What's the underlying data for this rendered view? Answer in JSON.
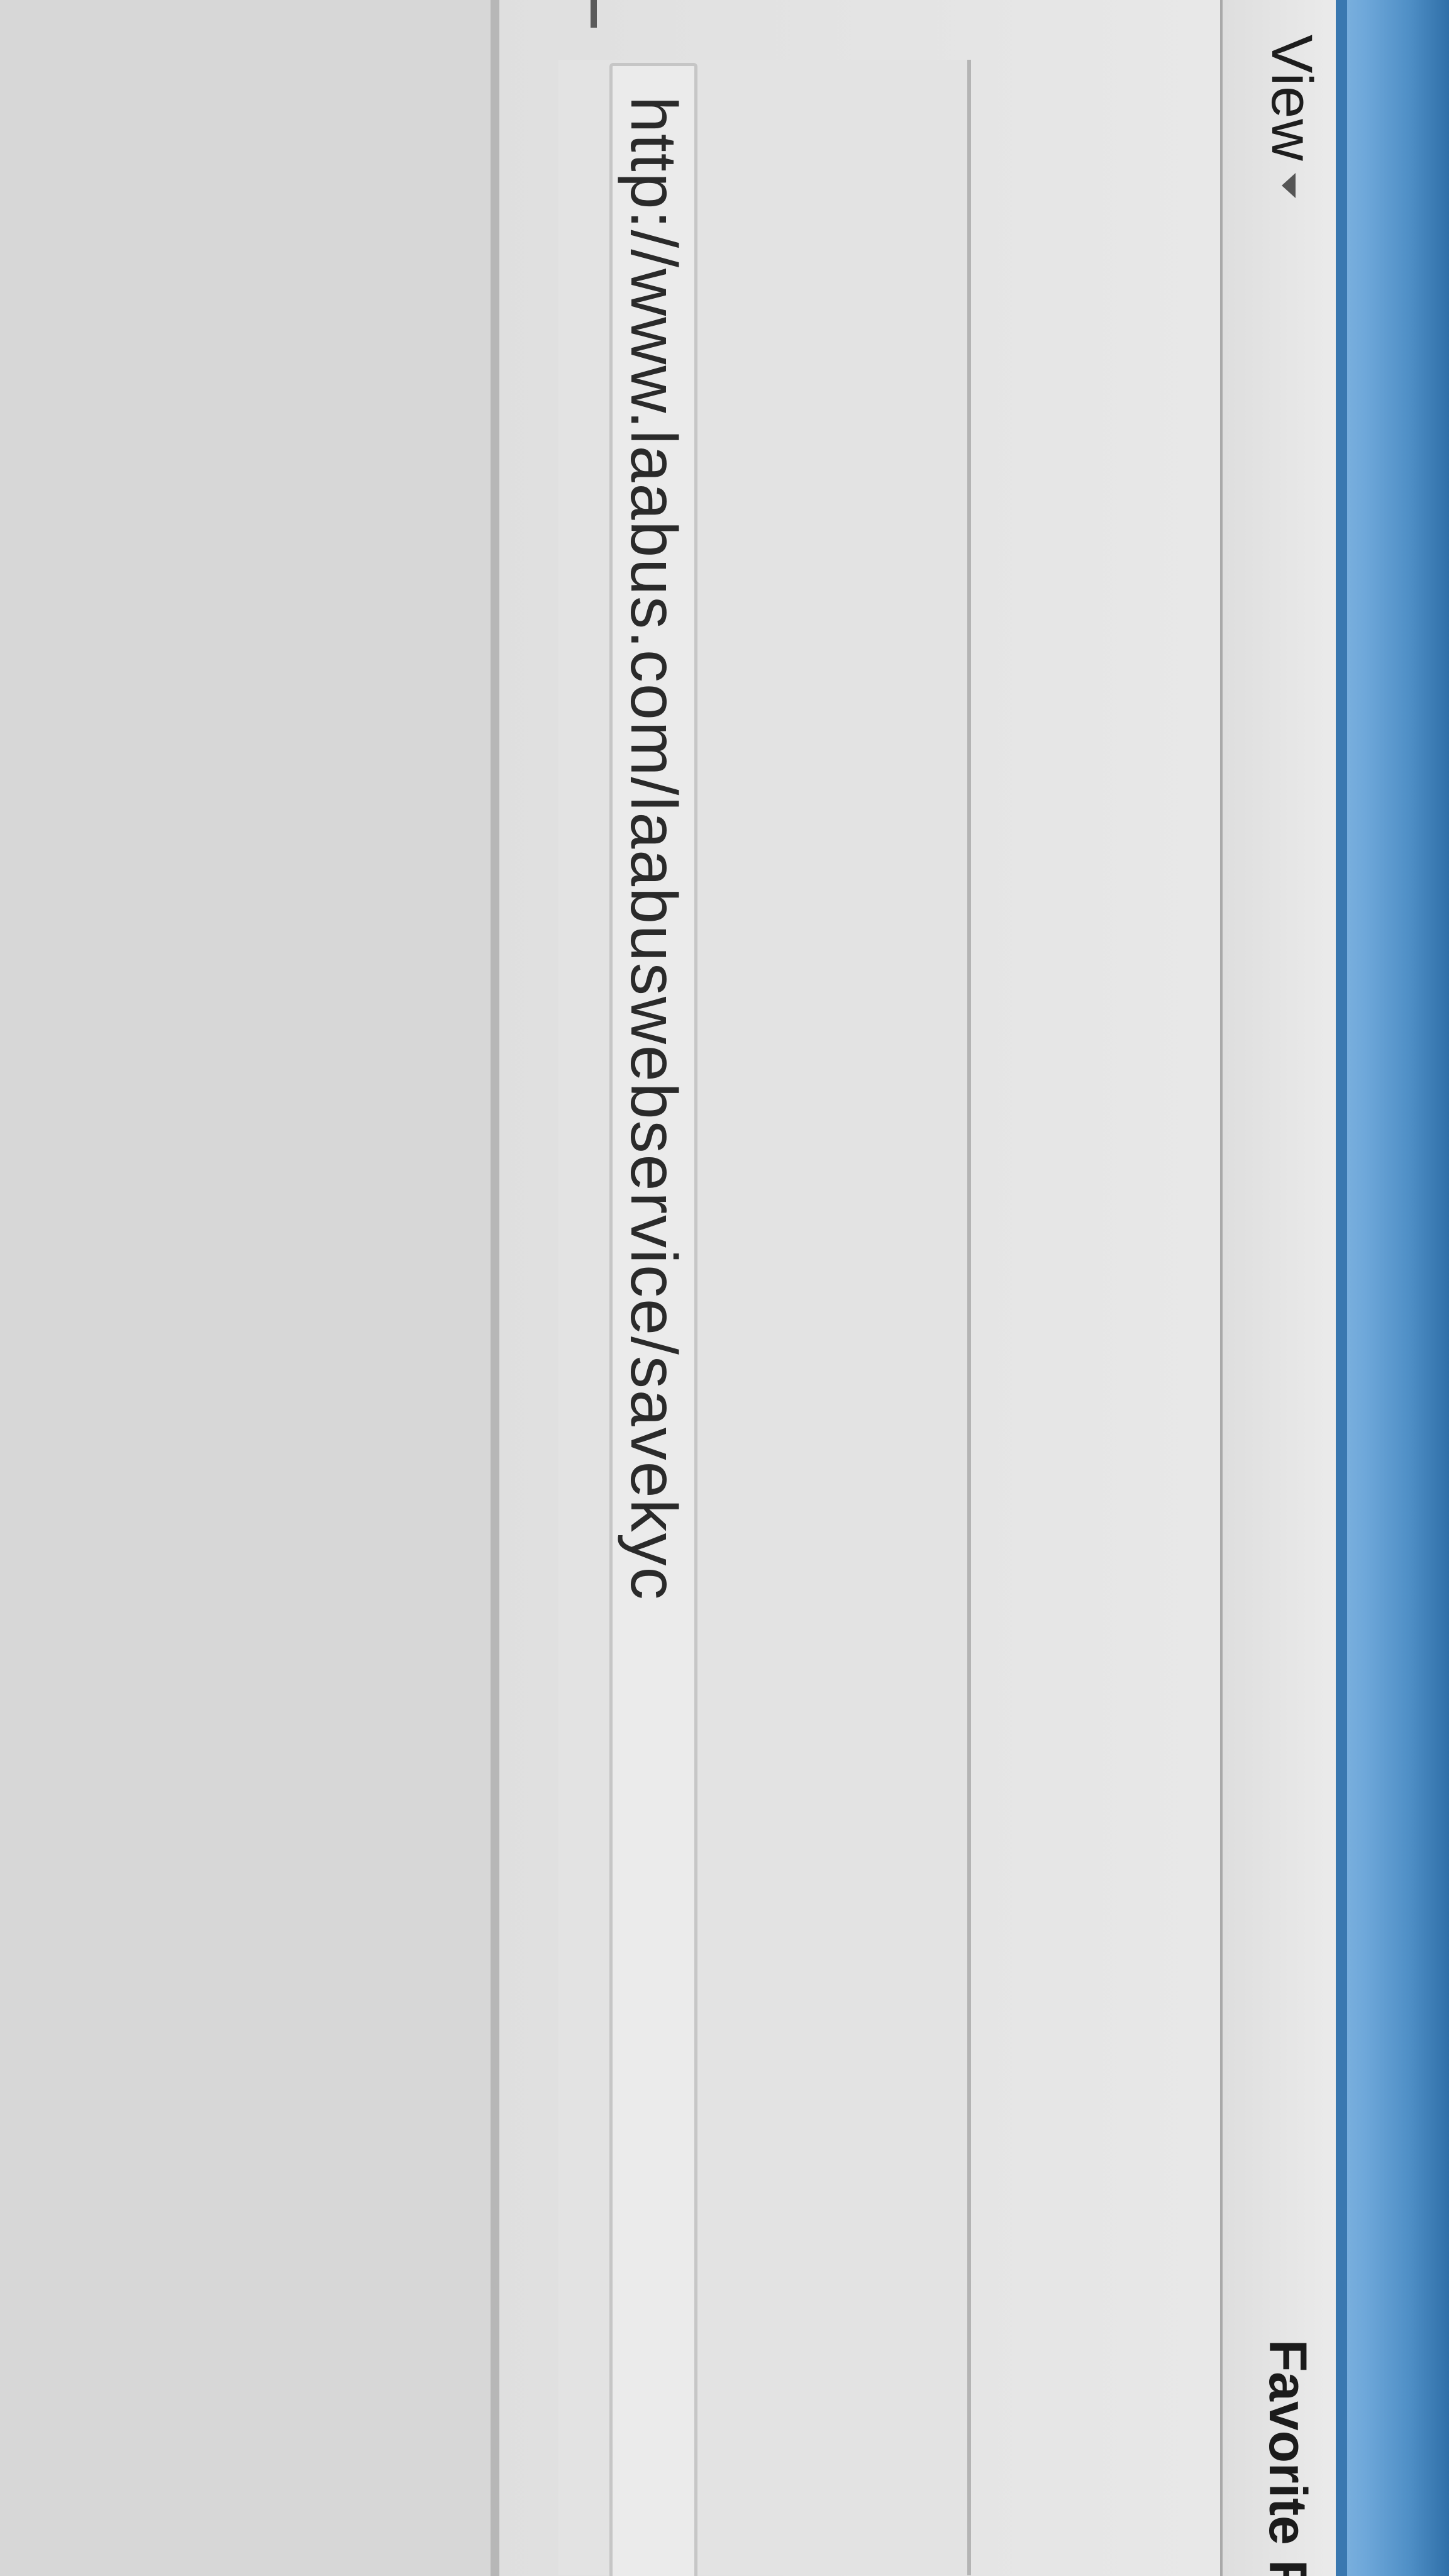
{
  "menubar": {
    "view_label": "View",
    "favorites_label": "Favorite F"
  },
  "address": {
    "url": "http://www.laabus.com/laabuswebservice/savekyc"
  },
  "colors": {
    "title_strip": "#4f8fc6",
    "menubar": "#e4e4e4",
    "text": "#2a2a2a"
  }
}
